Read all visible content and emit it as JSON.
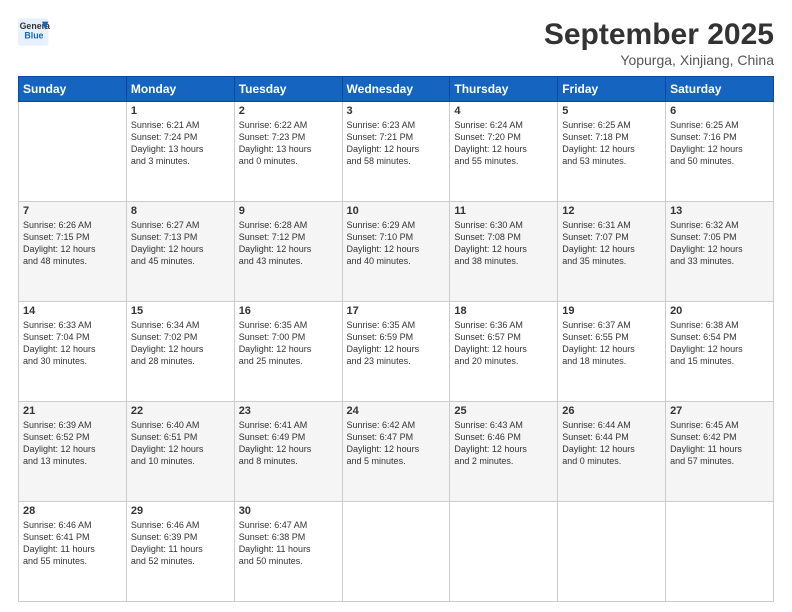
{
  "logo": {
    "line1": "General",
    "line2": "Blue"
  },
  "title": "September 2025",
  "location": "Yopurga, Xinjiang, China",
  "weekdays": [
    "Sunday",
    "Monday",
    "Tuesday",
    "Wednesday",
    "Thursday",
    "Friday",
    "Saturday"
  ],
  "weeks": [
    [
      {
        "day": "",
        "info": ""
      },
      {
        "day": "1",
        "info": "Sunrise: 6:21 AM\nSunset: 7:24 PM\nDaylight: 13 hours\nand 3 minutes."
      },
      {
        "day": "2",
        "info": "Sunrise: 6:22 AM\nSunset: 7:23 PM\nDaylight: 13 hours\nand 0 minutes."
      },
      {
        "day": "3",
        "info": "Sunrise: 6:23 AM\nSunset: 7:21 PM\nDaylight: 12 hours\nand 58 minutes."
      },
      {
        "day": "4",
        "info": "Sunrise: 6:24 AM\nSunset: 7:20 PM\nDaylight: 12 hours\nand 55 minutes."
      },
      {
        "day": "5",
        "info": "Sunrise: 6:25 AM\nSunset: 7:18 PM\nDaylight: 12 hours\nand 53 minutes."
      },
      {
        "day": "6",
        "info": "Sunrise: 6:25 AM\nSunset: 7:16 PM\nDaylight: 12 hours\nand 50 minutes."
      }
    ],
    [
      {
        "day": "7",
        "info": "Sunrise: 6:26 AM\nSunset: 7:15 PM\nDaylight: 12 hours\nand 48 minutes."
      },
      {
        "day": "8",
        "info": "Sunrise: 6:27 AM\nSunset: 7:13 PM\nDaylight: 12 hours\nand 45 minutes."
      },
      {
        "day": "9",
        "info": "Sunrise: 6:28 AM\nSunset: 7:12 PM\nDaylight: 12 hours\nand 43 minutes."
      },
      {
        "day": "10",
        "info": "Sunrise: 6:29 AM\nSunset: 7:10 PM\nDaylight: 12 hours\nand 40 minutes."
      },
      {
        "day": "11",
        "info": "Sunrise: 6:30 AM\nSunset: 7:08 PM\nDaylight: 12 hours\nand 38 minutes."
      },
      {
        "day": "12",
        "info": "Sunrise: 6:31 AM\nSunset: 7:07 PM\nDaylight: 12 hours\nand 35 minutes."
      },
      {
        "day": "13",
        "info": "Sunrise: 6:32 AM\nSunset: 7:05 PM\nDaylight: 12 hours\nand 33 minutes."
      }
    ],
    [
      {
        "day": "14",
        "info": "Sunrise: 6:33 AM\nSunset: 7:04 PM\nDaylight: 12 hours\nand 30 minutes."
      },
      {
        "day": "15",
        "info": "Sunrise: 6:34 AM\nSunset: 7:02 PM\nDaylight: 12 hours\nand 28 minutes."
      },
      {
        "day": "16",
        "info": "Sunrise: 6:35 AM\nSunset: 7:00 PM\nDaylight: 12 hours\nand 25 minutes."
      },
      {
        "day": "17",
        "info": "Sunrise: 6:35 AM\nSunset: 6:59 PM\nDaylight: 12 hours\nand 23 minutes."
      },
      {
        "day": "18",
        "info": "Sunrise: 6:36 AM\nSunset: 6:57 PM\nDaylight: 12 hours\nand 20 minutes."
      },
      {
        "day": "19",
        "info": "Sunrise: 6:37 AM\nSunset: 6:55 PM\nDaylight: 12 hours\nand 18 minutes."
      },
      {
        "day": "20",
        "info": "Sunrise: 6:38 AM\nSunset: 6:54 PM\nDaylight: 12 hours\nand 15 minutes."
      }
    ],
    [
      {
        "day": "21",
        "info": "Sunrise: 6:39 AM\nSunset: 6:52 PM\nDaylight: 12 hours\nand 13 minutes."
      },
      {
        "day": "22",
        "info": "Sunrise: 6:40 AM\nSunset: 6:51 PM\nDaylight: 12 hours\nand 10 minutes."
      },
      {
        "day": "23",
        "info": "Sunrise: 6:41 AM\nSunset: 6:49 PM\nDaylight: 12 hours\nand 8 minutes."
      },
      {
        "day": "24",
        "info": "Sunrise: 6:42 AM\nSunset: 6:47 PM\nDaylight: 12 hours\nand 5 minutes."
      },
      {
        "day": "25",
        "info": "Sunrise: 6:43 AM\nSunset: 6:46 PM\nDaylight: 12 hours\nand 2 minutes."
      },
      {
        "day": "26",
        "info": "Sunrise: 6:44 AM\nSunset: 6:44 PM\nDaylight: 12 hours\nand 0 minutes."
      },
      {
        "day": "27",
        "info": "Sunrise: 6:45 AM\nSunset: 6:42 PM\nDaylight: 11 hours\nand 57 minutes."
      }
    ],
    [
      {
        "day": "28",
        "info": "Sunrise: 6:46 AM\nSunset: 6:41 PM\nDaylight: 11 hours\nand 55 minutes."
      },
      {
        "day": "29",
        "info": "Sunrise: 6:46 AM\nSunset: 6:39 PM\nDaylight: 11 hours\nand 52 minutes."
      },
      {
        "day": "30",
        "info": "Sunrise: 6:47 AM\nSunset: 6:38 PM\nDaylight: 11 hours\nand 50 minutes."
      },
      {
        "day": "",
        "info": ""
      },
      {
        "day": "",
        "info": ""
      },
      {
        "day": "",
        "info": ""
      },
      {
        "day": "",
        "info": ""
      }
    ]
  ]
}
